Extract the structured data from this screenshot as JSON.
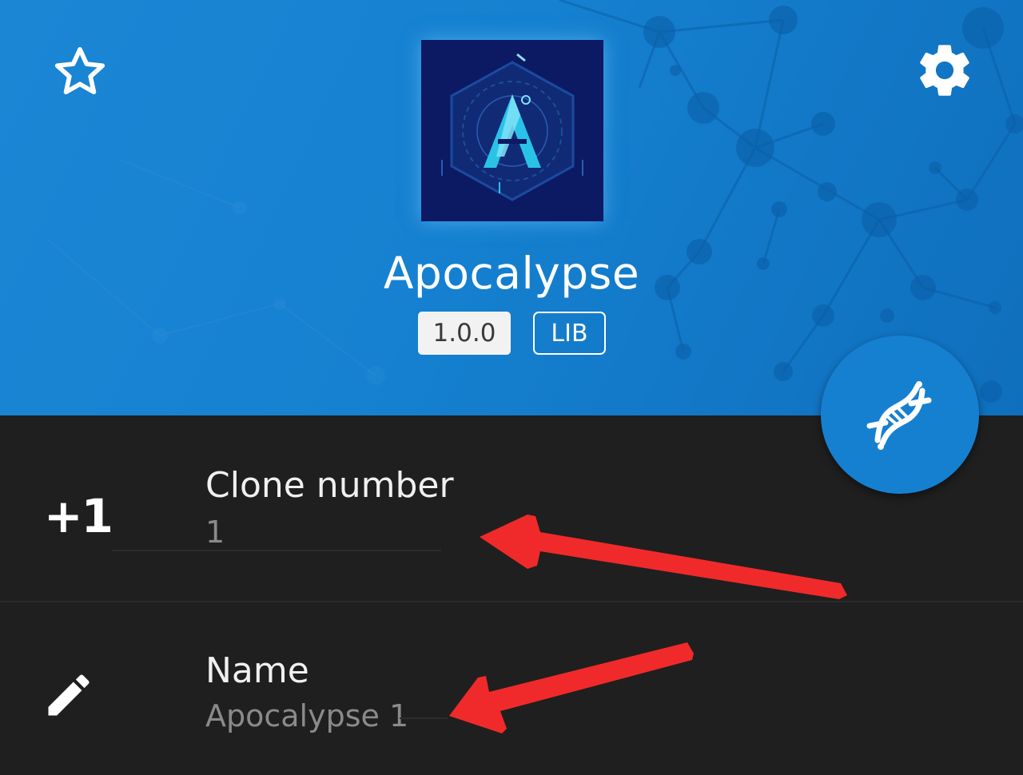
{
  "app": {
    "name": "Apocalypse",
    "version": "1.0.0",
    "type_badge": "LIB"
  },
  "header": {
    "favorite_icon": "star-outline-icon",
    "settings_icon": "gear-icon",
    "fab_icon": "dna-icon",
    "accent_color": "#1680d0"
  },
  "fields": {
    "clone_number": {
      "label": "Clone number",
      "value": "1",
      "icon": "plus-one-icon",
      "icon_text": "+1"
    },
    "name": {
      "label": "Name",
      "value": "Apocalypse 1",
      "icon": "pencil-icon"
    }
  },
  "annotations": {
    "arrow_color": "#f02a2a"
  }
}
